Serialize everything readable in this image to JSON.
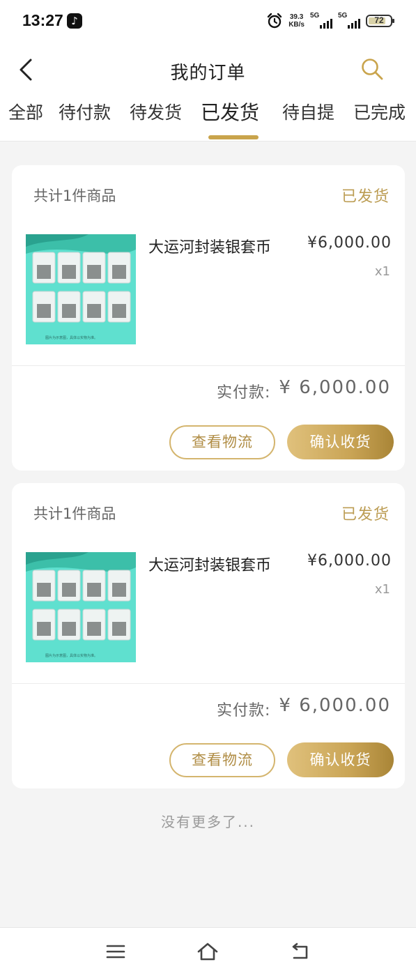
{
  "status_bar": {
    "time": "13:27",
    "speed_value": "39.3",
    "speed_unit": "KB/s",
    "network1": "5G",
    "network2": "5G",
    "battery": "72"
  },
  "header": {
    "title": "我的订单"
  },
  "tabs": [
    {
      "label": "全部",
      "active": false
    },
    {
      "label": "待付款",
      "active": false
    },
    {
      "label": "待发货",
      "active": false
    },
    {
      "label": "已发货",
      "active": true
    },
    {
      "label": "待自提",
      "active": false
    },
    {
      "label": "已完成",
      "active": false
    }
  ],
  "orders": [
    {
      "count_text": "共计1件商品",
      "status": "已发货",
      "product_name": "大运河封装银套币",
      "price": "¥6,000.00",
      "quantity": "x1",
      "image_caption": "图片为示意图，具体以实物为准。",
      "paid_label": "实付款:",
      "paid_value": "¥ 6,000.00",
      "logistics_button": "查看物流",
      "confirm_button": "确认收货"
    },
    {
      "count_text": "共计1件商品",
      "status": "已发货",
      "product_name": "大运河封装银套币",
      "price": "¥6,000.00",
      "quantity": "x1",
      "image_caption": "图片为示意图，具体以实物为准。",
      "paid_label": "实付款:",
      "paid_value": "¥ 6,000.00",
      "logistics_button": "查看物流",
      "confirm_button": "确认收货"
    }
  ],
  "footer_text": "没有更多了...",
  "colors": {
    "accent": "#c9a44c",
    "status_text": "#bc9d54",
    "thumb_bg": "#5fe0cf"
  },
  "icons": {
    "back": "chevron-left-icon",
    "search": "search-icon",
    "nav_menu": "menu-icon",
    "nav_home": "home-icon",
    "nav_back": "back-arrow-icon"
  }
}
